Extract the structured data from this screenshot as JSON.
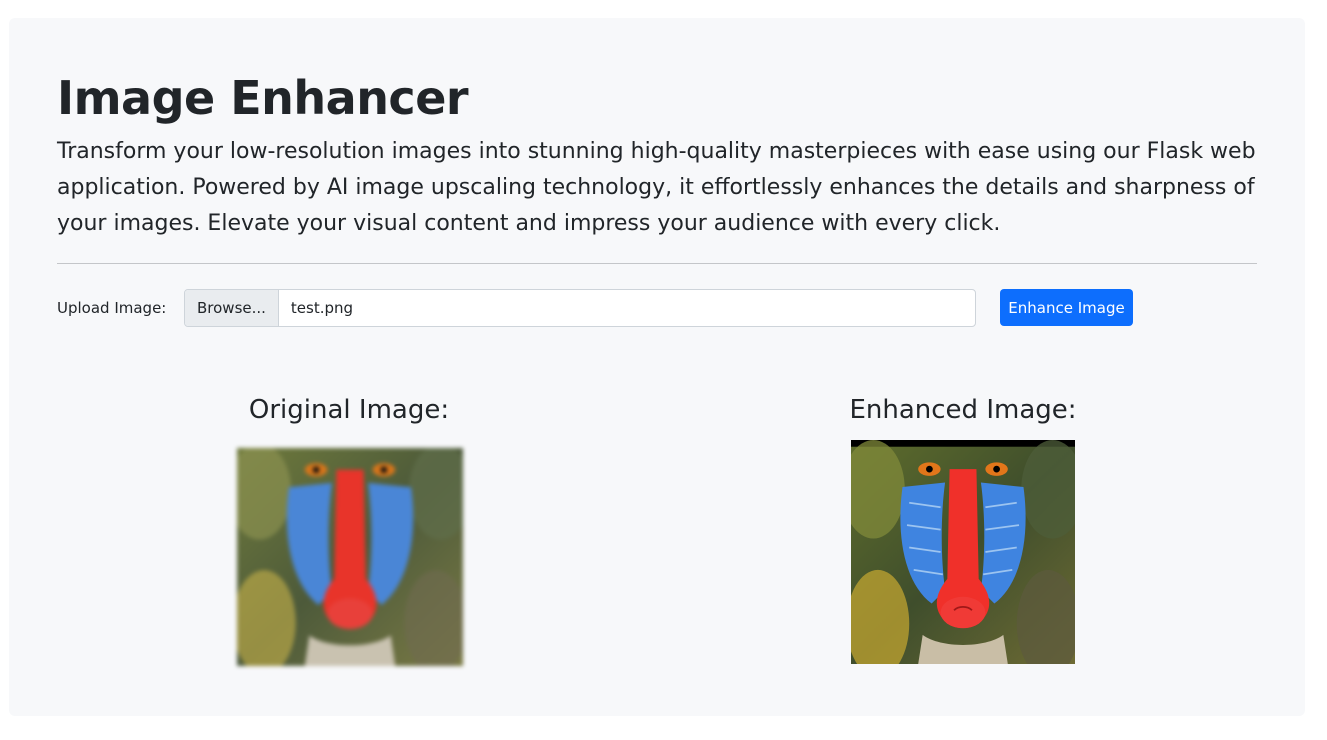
{
  "page": {
    "title": "Image Enhancer",
    "description": "Transform your low-resolution images into stunning high-quality masterpieces with ease using our Flask web application. Powered by AI image upscaling technology, it effortlessly enhances the details and sharpness of your images. Elevate your visual content and impress your audience with every click."
  },
  "upload": {
    "label": "Upload Image:",
    "browse_label": "Browse...",
    "file_name": "test.png",
    "submit_label": "Enhance Image"
  },
  "results": {
    "original_caption": "Original Image:",
    "enhanced_caption": "Enhanced Image:"
  },
  "colors": {
    "primary": "#0d6efd",
    "background": "#f7f8fa",
    "text": "#212529"
  }
}
